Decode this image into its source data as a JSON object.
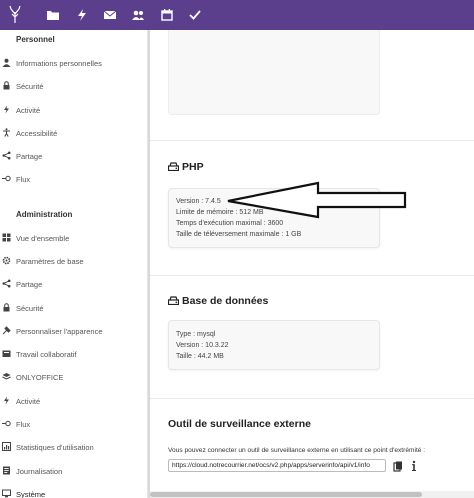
{
  "topbar": {
    "icons": [
      "app-logo-icon",
      "files-icon",
      "activity-icon",
      "mail-icon",
      "contacts-icon",
      "calendar-icon",
      "tasks-icon"
    ]
  },
  "sidebar": {
    "personal_title": "Personnel",
    "personal_items": [
      {
        "label": "Informations personnelles",
        "icon": "person-icon"
      },
      {
        "label": "Sécurité",
        "icon": "lock-icon"
      },
      {
        "label": "Activité",
        "icon": "activity-icon"
      },
      {
        "label": "Accessibilité",
        "icon": "accessibility-icon"
      },
      {
        "label": "Partage",
        "icon": "share-icon"
      },
      {
        "label": "Flux",
        "icon": "flow-icon"
      }
    ],
    "admin_title": "Administration",
    "admin_items": [
      {
        "label": "Vue d'ensemble",
        "icon": "overview-icon"
      },
      {
        "label": "Paramètres de base",
        "icon": "gear-icon"
      },
      {
        "label": "Partage",
        "icon": "share-icon"
      },
      {
        "label": "Sécurité",
        "icon": "lock-icon"
      },
      {
        "label": "Personnaliser l'apparence",
        "icon": "theming-icon"
      },
      {
        "label": "Travail collaboratif",
        "icon": "groupware-icon"
      },
      {
        "label": "ONLYOFFICE",
        "icon": "onlyoffice-icon"
      },
      {
        "label": "Activité",
        "icon": "activity-icon"
      },
      {
        "label": "Flux",
        "icon": "flow-icon"
      },
      {
        "label": "Statistiques d'utilisation",
        "icon": "stats-icon"
      },
      {
        "label": "Journalisation",
        "icon": "log-icon"
      },
      {
        "label": "Système",
        "icon": "system-icon"
      }
    ]
  },
  "php": {
    "title": "PHP",
    "rows": [
      "Version : 7.4.5",
      "Limite de mémoire : 512 MB",
      "Temps d'exécution maximal : 3600",
      "Taille de téléversement maximale : 1 GB"
    ]
  },
  "database": {
    "title": "Base de données",
    "rows": [
      "Type : mysql",
      "Version : 10.3.22",
      "Taille : 44.2 MB"
    ]
  },
  "monitoring": {
    "title": "Outil de surveillance externe",
    "description": "Vous pouvez connecter un outil de surveillance externe en utilisant ce point d'extrémité :",
    "url": "https://cloud.notrecourrier.net/ocs/v2.php/apps/serverinfo/api/v1/info"
  },
  "colors": {
    "header": "#5b3f8c",
    "panel": "#f8f8f8"
  }
}
